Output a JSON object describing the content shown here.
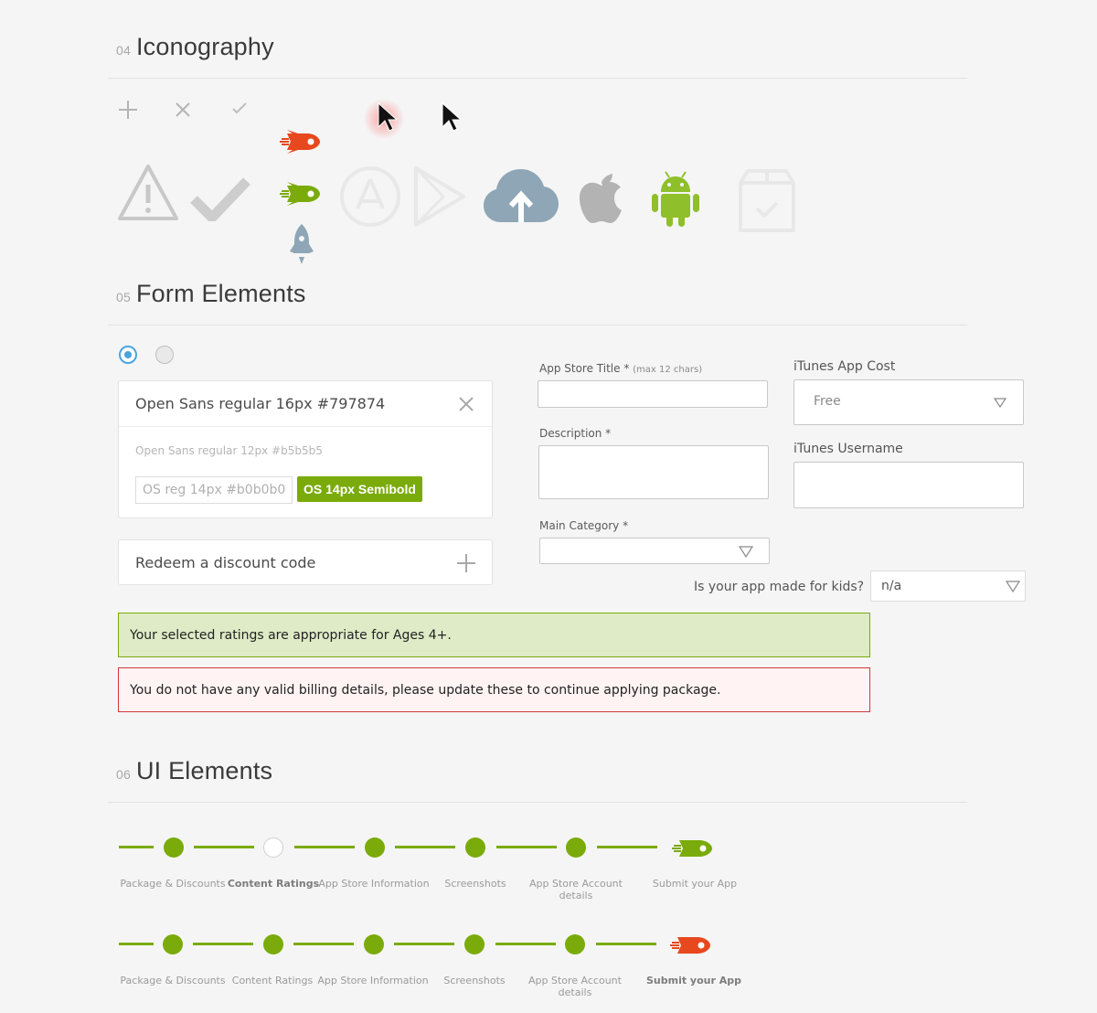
{
  "sections": {
    "iconography": {
      "num": "04",
      "title": "Iconography"
    },
    "forms": {
      "num": "05",
      "title": "Form Elements"
    },
    "ui": {
      "num": "06",
      "title": "UI Elements"
    }
  },
  "icons": [
    "plus-icon",
    "close-icon",
    "check-icon",
    "cursor-red-glow-icon",
    "cursor-icon",
    "rocket-red-icon",
    "rocket-green-icon",
    "rocket-grey-icon",
    "warning-icon",
    "large-check-icon",
    "app-store-icon",
    "play-store-icon",
    "cloud-upload-icon",
    "apple-icon",
    "android-icon",
    "package-check-icon"
  ],
  "colors": {
    "green": "#7aab0a",
    "blue": "#4aa3df",
    "red": "#d0393a",
    "rocket_red": "#e8481e",
    "cloud": "#8ea6b6"
  },
  "form": {
    "card_title": "Open Sans regular 16px #797874",
    "card_small": "Open Sans regular 12px #b5b5b5",
    "tag_text": "OS reg 14px #b0b0b0",
    "green_button": "OS 14px Semibold",
    "redeem": "Redeem a discount code",
    "app_store_title_label": "App Store Title *",
    "app_store_title_hint": "(max 12 chars)",
    "description_label": "Description *",
    "main_category_label": "Main Category *",
    "itunes_cost_label": "iTunes App Cost",
    "itunes_cost_value": "Free",
    "itunes_username_label": "iTunes Username",
    "kids_label": "Is your app made for kids?",
    "kids_value": "n/a",
    "alert_ok": "Your selected ratings are appropriate for Ages 4+.",
    "alert_err": "You do not have any valid billing details, please update these to continue applying package."
  },
  "stepper_1": {
    "active": "Content Ratings",
    "steps": [
      "Package & Discounts",
      "Content Ratings",
      "App Store Information",
      "Screenshots",
      "App Store Account details",
      "Submit your App"
    ]
  },
  "stepper_2": {
    "active": "Submit your App",
    "steps": [
      "Package & Discounts",
      "Content Ratings",
      "App Store Information",
      "Screenshots",
      "App Store Account details",
      "Submit your App"
    ]
  }
}
